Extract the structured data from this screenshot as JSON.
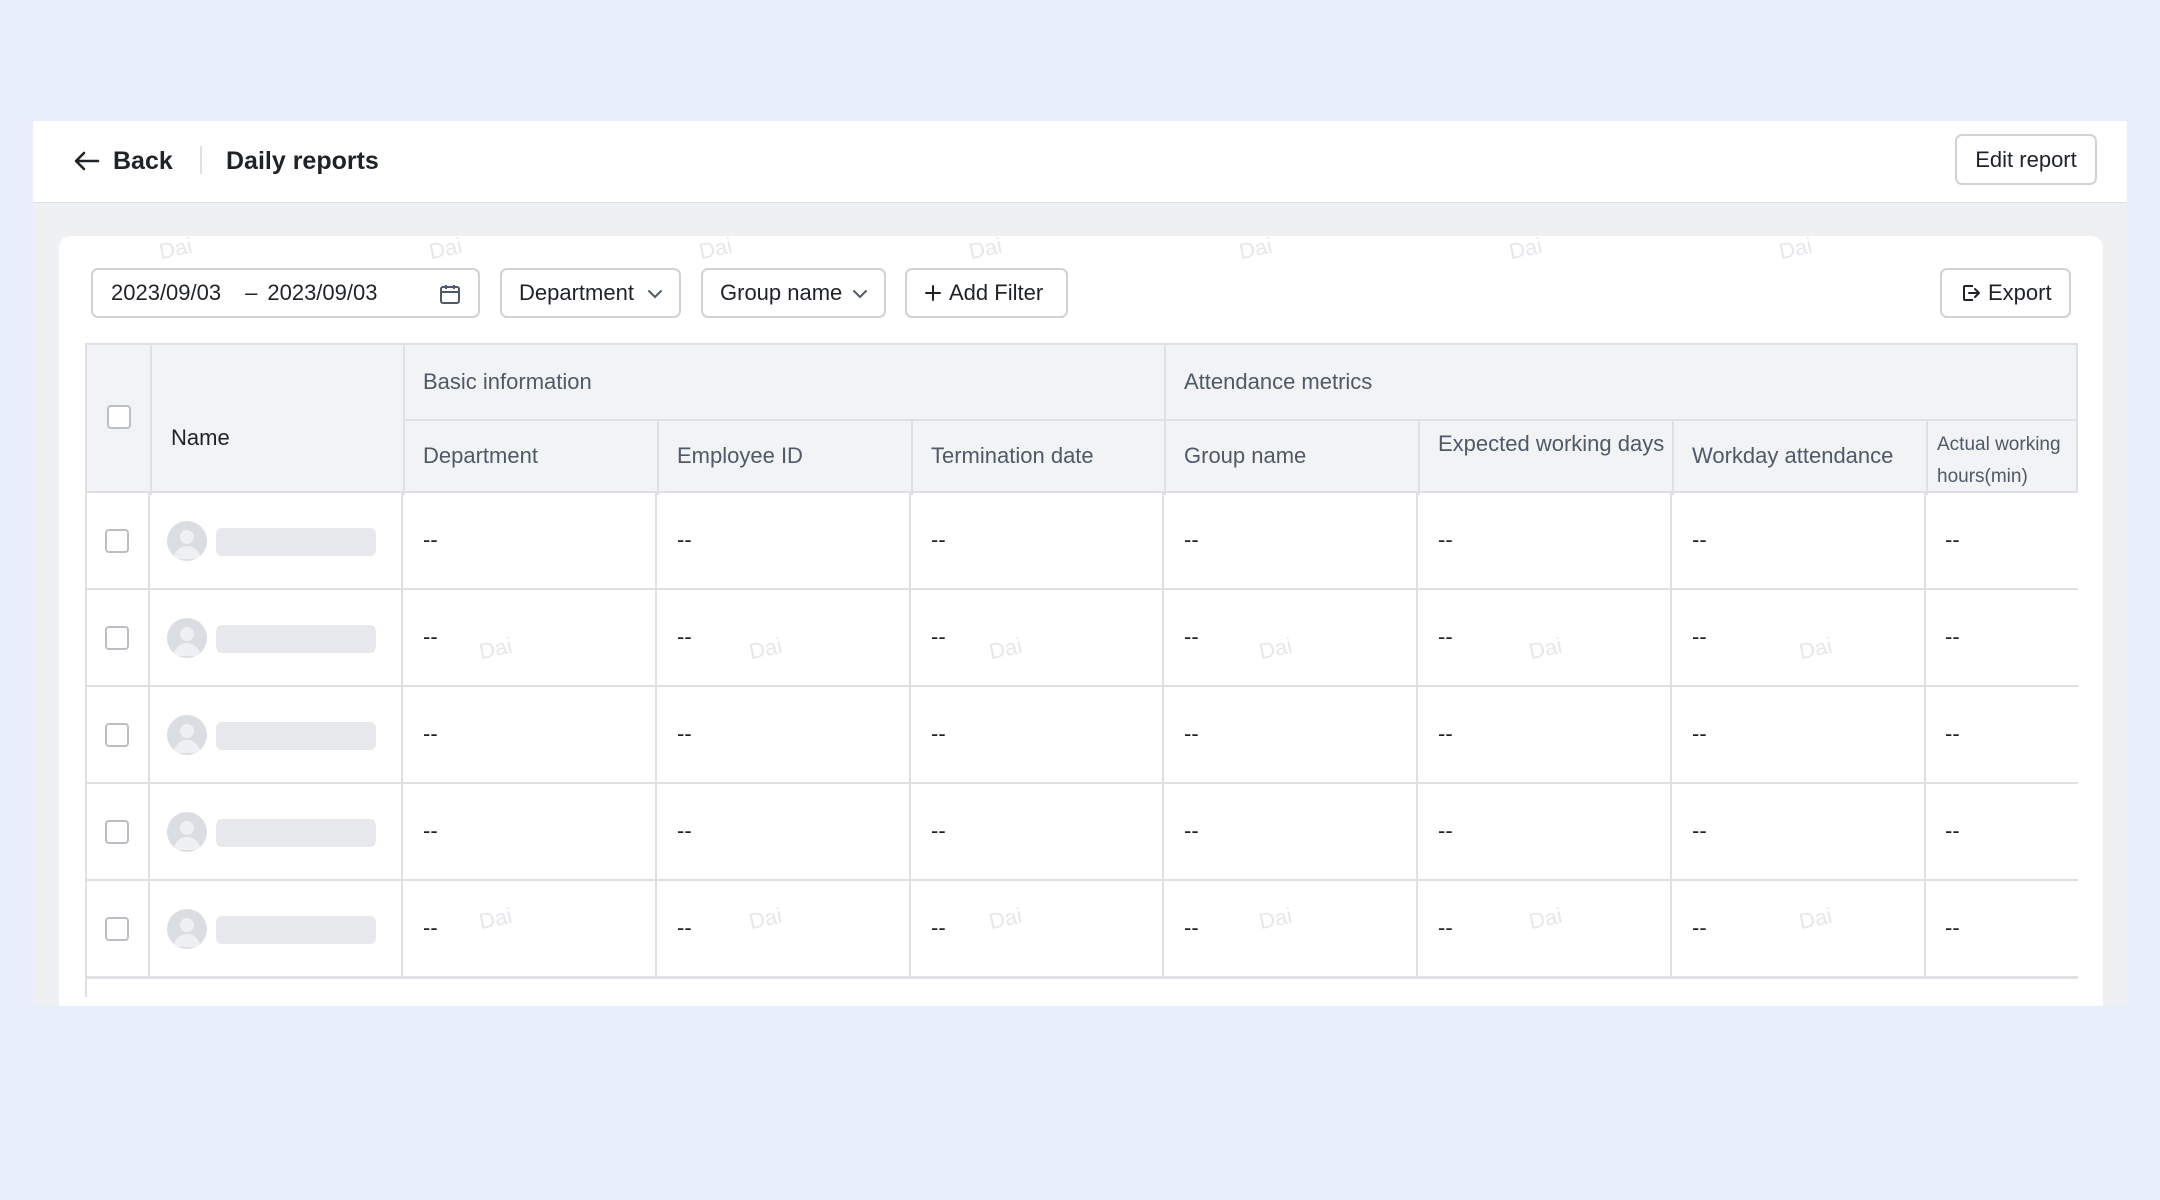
{
  "header": {
    "back_label": "Back",
    "title": "Daily reports",
    "edit_label": "Edit report"
  },
  "toolbar": {
    "date_start": "2023/09/03",
    "date_sep": "–",
    "date_end": "2023/09/03",
    "department_label": "Department",
    "group_label": "Group name",
    "add_filter_label": "Add Filter",
    "export_label": "Export"
  },
  "table": {
    "name_header": "Name",
    "groups": [
      "Basic information",
      "Attendance metrics"
    ],
    "columns": [
      "Department",
      "Employee ID",
      "Termination date",
      "Group name",
      "Expected working days",
      "Workday attendance",
      "Actual working hours(min)"
    ],
    "rows": [
      [
        "--",
        "--",
        "--",
        "--",
        "--",
        "--",
        "--"
      ],
      [
        "--",
        "--",
        "--",
        "--",
        "--",
        "--",
        "--"
      ],
      [
        "--",
        "--",
        "--",
        "--",
        "--",
        "--",
        "--"
      ],
      [
        "--",
        "--",
        "--",
        "--",
        "--",
        "--",
        "--"
      ],
      [
        "--",
        "--",
        "--",
        "--",
        "--",
        "--",
        "--"
      ]
    ]
  },
  "watermark": "Dai"
}
